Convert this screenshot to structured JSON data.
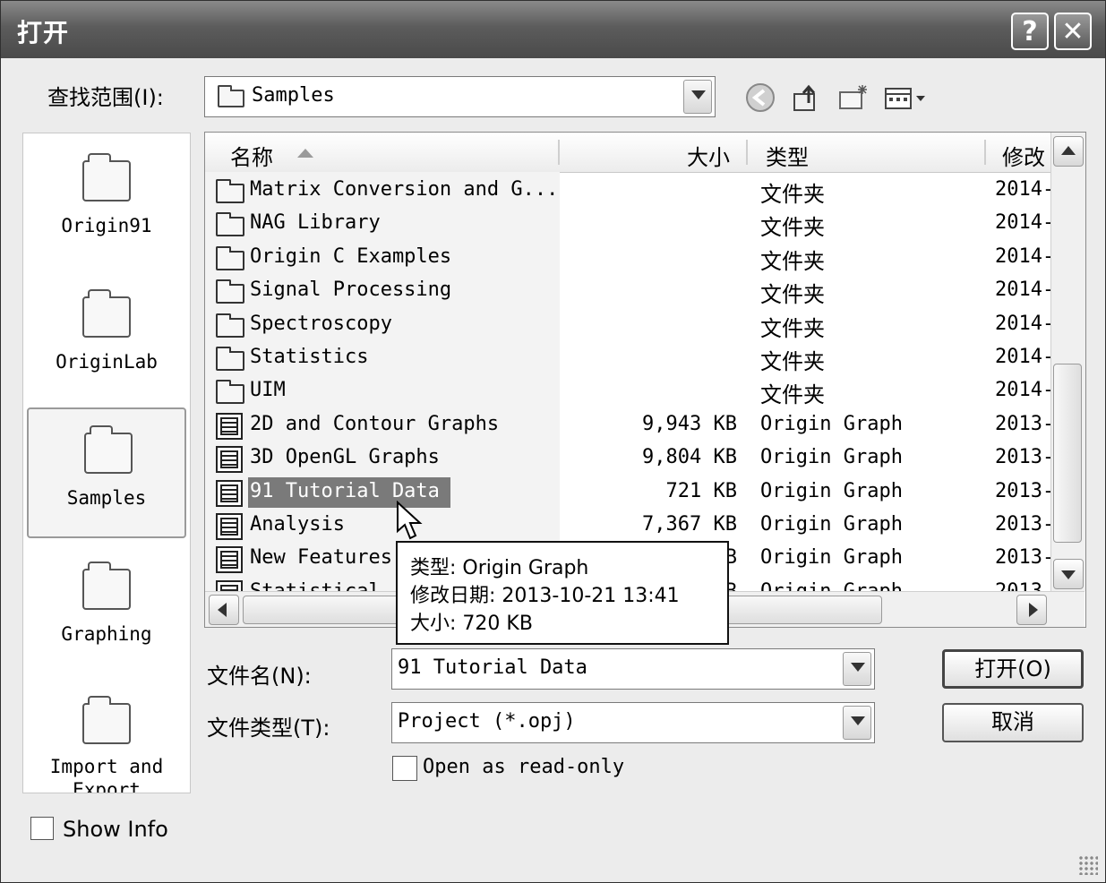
{
  "window": {
    "title": "打开",
    "help_glyph": "?",
    "close_glyph": "✕"
  },
  "lookin": {
    "label": "查找范围(I):",
    "value": "Samples"
  },
  "places": [
    {
      "label": "Origin91"
    },
    {
      "label": "OriginLab"
    },
    {
      "label": "Samples"
    },
    {
      "label": "Graphing"
    },
    {
      "label": "Import and Export"
    }
  ],
  "columns": {
    "name": "名称",
    "size": "大小",
    "type": "类型",
    "modified": "修改"
  },
  "files": [
    {
      "name": "Matrix Conversion and G...",
      "size": "",
      "type": "文件夹",
      "modified": "2014-",
      "kind": "folder"
    },
    {
      "name": "NAG Library",
      "size": "",
      "type": "文件夹",
      "modified": "2014-",
      "kind": "folder"
    },
    {
      "name": "Origin C Examples",
      "size": "",
      "type": "文件夹",
      "modified": "2014-",
      "kind": "folder"
    },
    {
      "name": "Signal Processing",
      "size": "",
      "type": "文件夹",
      "modified": "2014-",
      "kind": "folder"
    },
    {
      "name": "Spectroscopy",
      "size": "",
      "type": "文件夹",
      "modified": "2014-",
      "kind": "folder"
    },
    {
      "name": "Statistics",
      "size": "",
      "type": "文件夹",
      "modified": "2014-",
      "kind": "folder"
    },
    {
      "name": "UIM",
      "size": "",
      "type": "文件夹",
      "modified": "2014-",
      "kind": "folder"
    },
    {
      "name": "2D and Contour Graphs",
      "size": "9,943 KB",
      "type": "Origin Graph",
      "modified": "2013-",
      "kind": "graph"
    },
    {
      "name": "3D OpenGL Graphs",
      "size": "9,804 KB",
      "type": "Origin Graph",
      "modified": "2013-",
      "kind": "graph"
    },
    {
      "name": "91 Tutorial Data",
      "size": "721 KB",
      "type": "Origin Graph",
      "modified": "2013-",
      "kind": "graph",
      "selected": true
    },
    {
      "name": "Analysis",
      "size": "7,367 KB",
      "type": "Origin Graph",
      "modified": "2013-",
      "kind": "graph"
    },
    {
      "name": "New Features",
      "size": "KB",
      "type": "Origin Graph",
      "modified": "2013-",
      "kind": "graph"
    },
    {
      "name": "Statistical ...",
      "size": "KB",
      "type": "Origin Graph",
      "modified": "2013-",
      "kind": "graph"
    }
  ],
  "tooltip": {
    "type": "类型: Origin Graph",
    "modified": "修改日期: 2013-10-21 13:41",
    "size": "大小: 720 KB"
  },
  "filename": {
    "label": "文件名(N):",
    "value": "91 Tutorial Data"
  },
  "filetype": {
    "label": "文件类型(T):",
    "value": "Project (*.opj)"
  },
  "readonly": {
    "label": "Open as read-only"
  },
  "showinfo": {
    "label": "Show Info"
  },
  "buttons": {
    "open": "打开(O)",
    "cancel": "取消"
  }
}
